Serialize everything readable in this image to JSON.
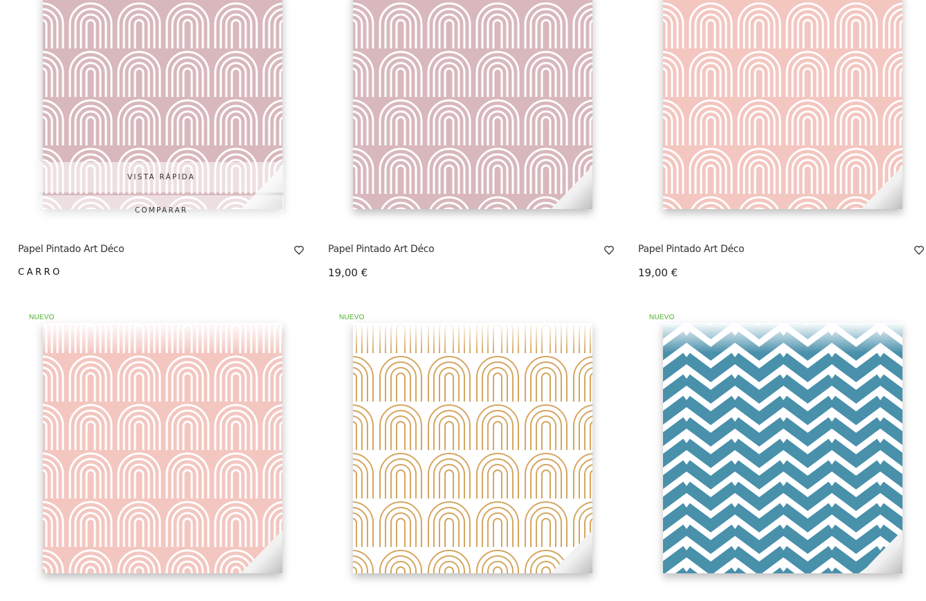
{
  "products_row1": [
    {
      "title": "Papel Pintado Art Déco",
      "quick_view": "VISTA RÁPIDA",
      "compare": "COMPARAR",
      "cart": "CARRO",
      "pattern_color": "#d8b8bc"
    },
    {
      "title": "Papel Pintado Art Déco",
      "price": "19,00 €",
      "pattern_color": "#d8b8bc"
    },
    {
      "title": "Papel Pintado Art Déco",
      "price": "19,00 €",
      "pattern_color": "#f3c6c0"
    }
  ],
  "products_row2": [
    {
      "badge": "NUEVO",
      "pattern": "arches-pink",
      "pattern_color": "#f3c6c0"
    },
    {
      "badge": "NUEVO",
      "pattern": "arches-gold",
      "pattern_color": "#d4a660"
    },
    {
      "badge": "NUEVO",
      "pattern": "chevron-blue",
      "pattern_color": "#4a90ab"
    }
  ],
  "icons": {
    "wishlist": "heart-icon"
  }
}
